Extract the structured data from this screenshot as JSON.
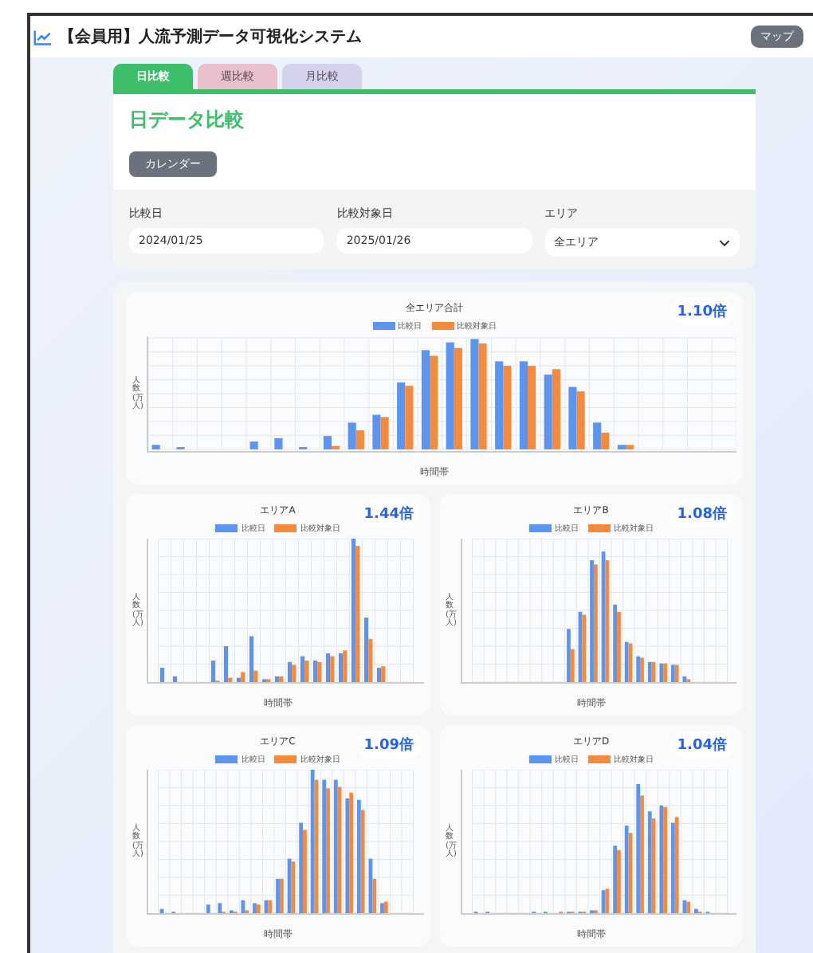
{
  "header": {
    "title": "【会員用】人流予測データ可視化システム",
    "map_button": "マップ"
  },
  "tabs": [
    {
      "label": "日比較",
      "selected": true,
      "color": "#3dbf6a"
    },
    {
      "label": "週比較",
      "selected": false,
      "color": "#e9bfcb"
    },
    {
      "label": "月比較",
      "selected": false,
      "color": "#d4d2ec"
    }
  ],
  "section_title": "日データ比較",
  "calendar_button": "カレンダー",
  "filters": [
    {
      "label": "比較日",
      "value": "2024/01/25",
      "kind": "input"
    },
    {
      "label": "比較対象日",
      "value": "2025/01/26",
      "kind": "input"
    },
    {
      "label": "エリア",
      "value": "全エリア",
      "kind": "select"
    }
  ],
  "charts": [
    {
      "title": "全エリア合計",
      "ratio": "1.10倍",
      "legend": [
        "比較日",
        "比較対象日"
      ],
      "xlabel": "時間帯",
      "ylabel": "人数(万人)"
    },
    {
      "title": "エリアA",
      "ratio": "1.44倍",
      "legend": [
        "比較日",
        "比較対象日"
      ],
      "xlabel": "時間帯",
      "ylabel": "人数(万人)"
    },
    {
      "title": "エリアB",
      "ratio": "1.08倍",
      "legend": [
        "比較日",
        "比較対象日"
      ],
      "xlabel": "時間帯",
      "ylabel": "人数(万人)"
    },
    {
      "title": "エリアC",
      "ratio": "1.09倍",
      "legend": [
        "比較日",
        "比較対象日"
      ],
      "xlabel": "時間帯",
      "ylabel": "人数(万人)"
    },
    {
      "title": "エリアD",
      "ratio": "1.04倍",
      "legend": [
        "比較日",
        "比較対象日"
      ],
      "xlabel": "時間帯",
      "ylabel": "人数(万人)"
    }
  ]
}
